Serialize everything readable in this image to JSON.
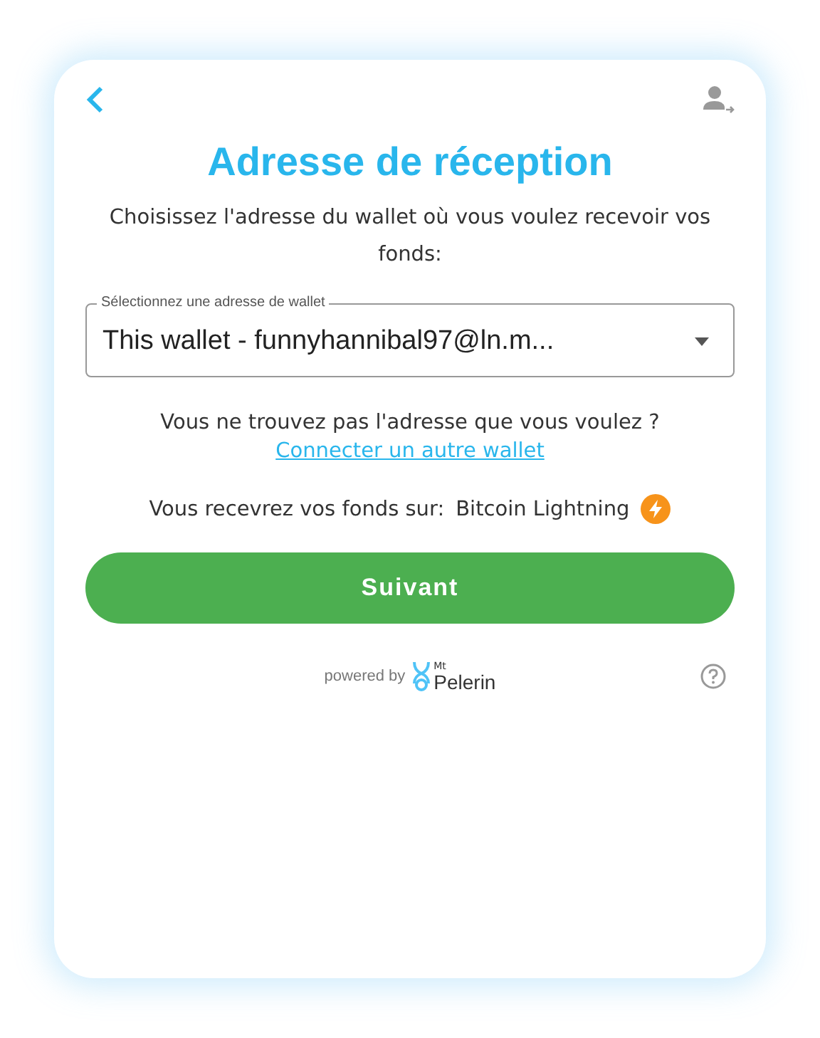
{
  "title": "Adresse de réception",
  "instruction": "Choisissez l'adresse du wallet où vous voulez recevoir vos fonds:",
  "wallet_select": {
    "label": "Sélectionnez une adresse de wallet",
    "value": "This wallet - funnyhannibal97@ln.m..."
  },
  "not_found": {
    "text": "Vous ne trouvez pas l'adresse que vous voulez ?",
    "link": "Connecter un autre wallet"
  },
  "network": {
    "label": "Vous recevrez vos fonds sur:",
    "value": "Bitcoin Lightning"
  },
  "next_button": "Suivant",
  "footer": {
    "powered_by": "powered by",
    "logo_small": "Mt",
    "logo_name": "Pelerin"
  }
}
